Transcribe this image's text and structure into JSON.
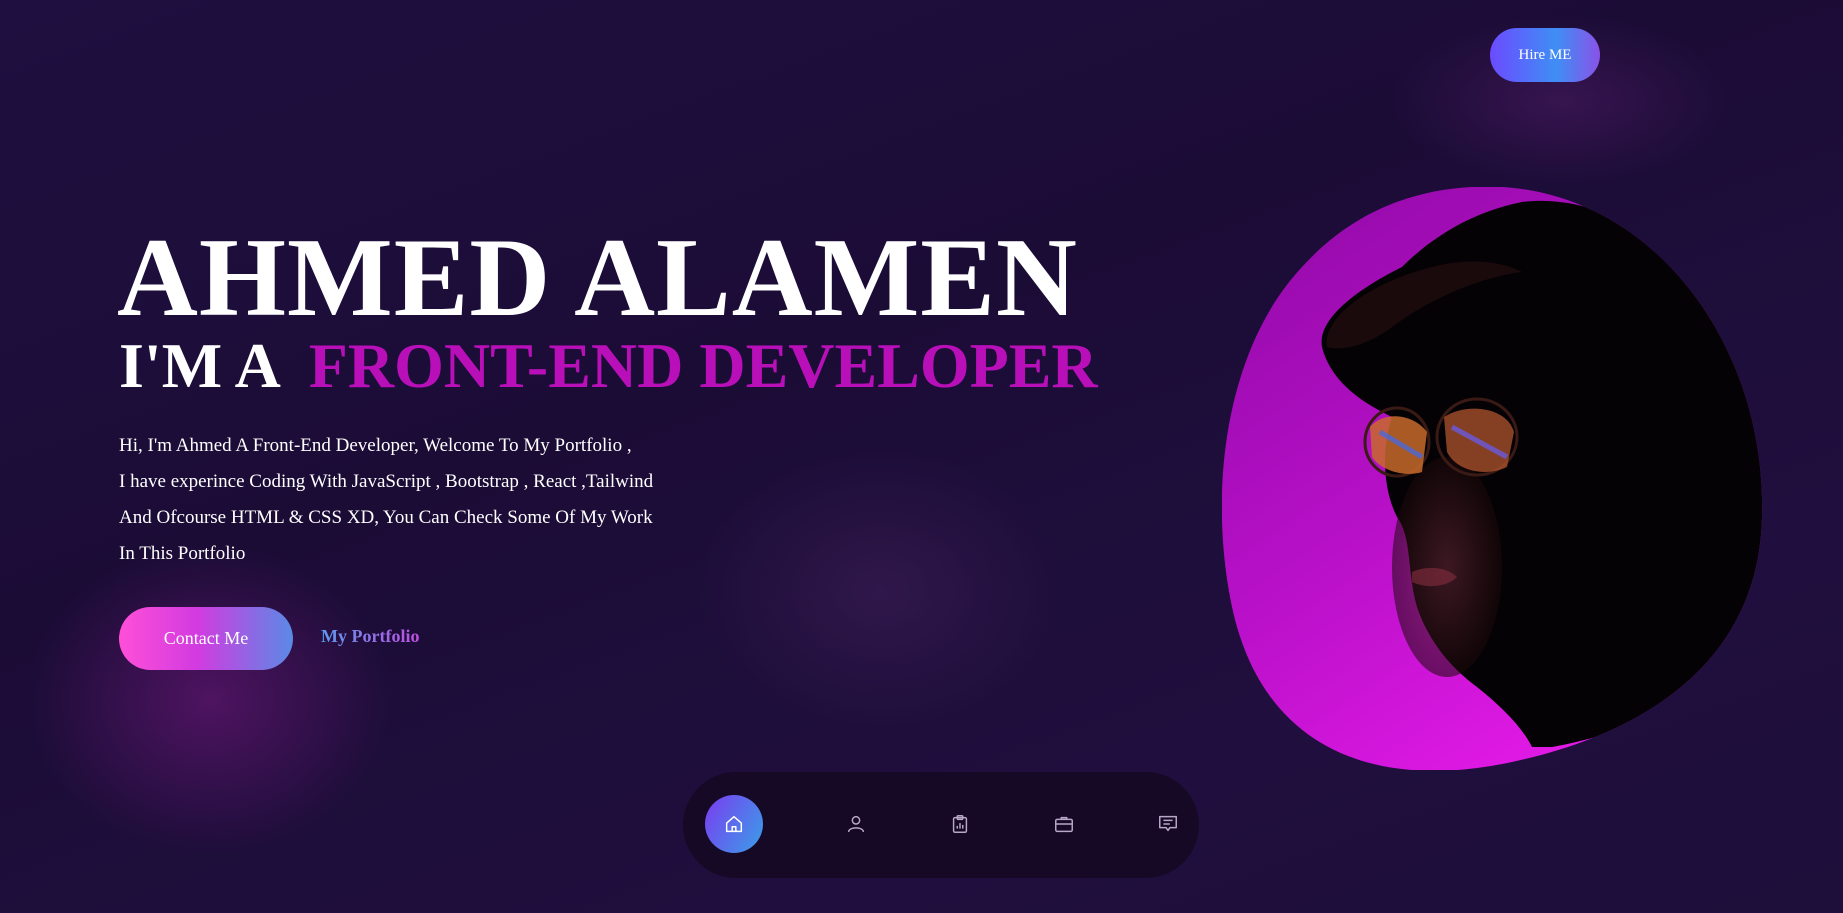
{
  "header": {
    "hire_label": "Hire ME"
  },
  "hero": {
    "name": "AHMED ALAMEN",
    "role_prefix": "I'M A",
    "role": "FRONT-END DEVELOPER",
    "description_lines": [
      "Hi, I'm Ahmed A Front-End Developer, Welcome To My Portfolio ,",
      "I have experince Coding With JavaScript , Bootstrap , React ,Tailwind",
      "And Ofcourse HTML & CSS XD, You Can Check Some Of My Work",
      "In This Portfolio"
    ],
    "contact_label": "Contact Me",
    "portfolio_label": "My Portfolio"
  },
  "dock": {
    "items": [
      {
        "name": "home",
        "icon": "home-icon",
        "active": true
      },
      {
        "name": "about",
        "icon": "user-icon",
        "active": false
      },
      {
        "name": "skills",
        "icon": "clipboard-chart-icon",
        "active": false
      },
      {
        "name": "portfolio",
        "icon": "briefcase-icon",
        "active": false
      },
      {
        "name": "contact",
        "icon": "message-icon",
        "active": false
      }
    ]
  },
  "colors": {
    "background": "#1e0e3c",
    "accent_magenta": "#b80fb9",
    "button_gradient_start": "#ff4fd8",
    "button_gradient_end": "#5a8ae6",
    "dock_active_start": "#7a3cf0",
    "dock_active_end": "#3a9fe8"
  }
}
